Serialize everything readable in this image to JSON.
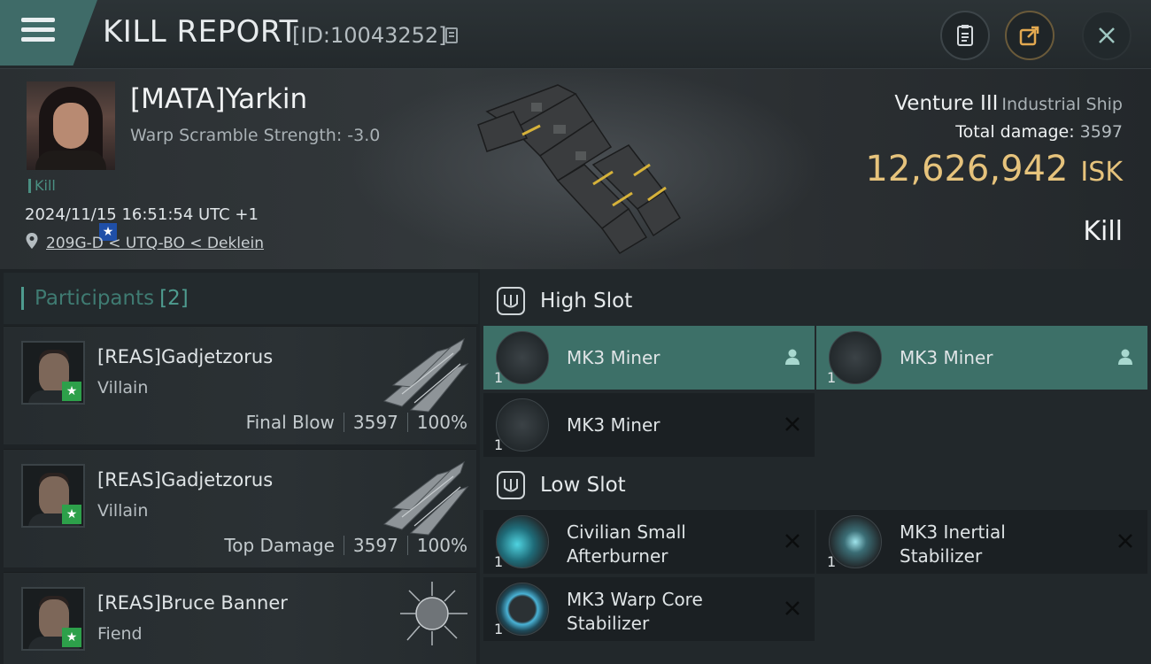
{
  "header": {
    "title": "KILL REPORT",
    "report_id": "[ID:10043252]"
  },
  "victim": {
    "name": "[MATA]Yarkin",
    "warp_scramble": "Warp Scramble Strength: -3.0",
    "tag": "Kill",
    "timestamp": "2024/11/15 16:51:54 UTC +1",
    "location": "209G-D < UTQ-BO < Deklein"
  },
  "ship": {
    "name": "Venture III",
    "class": "Industrial Ship",
    "total_damage_label": "Total damage:",
    "total_damage": "3597",
    "value": "12,626,942",
    "currency": "ISK",
    "result": "Kill"
  },
  "participants": {
    "label": "Participants",
    "count": "[2]",
    "rows": [
      {
        "name": "[REAS]Gadjetzorus",
        "role": "Villain",
        "stat_label": "Final Blow",
        "damage": "3597",
        "percent": "100%"
      },
      {
        "name": "[REAS]Gadjetzorus",
        "role": "Villain",
        "stat_label": "Top Damage",
        "damage": "3597",
        "percent": "100%"
      },
      {
        "name": "[REAS]Bruce Banner",
        "role": "Fiend"
      }
    ]
  },
  "slots": {
    "high": {
      "label": "High Slot",
      "modules": [
        {
          "name": "MK3 Miner",
          "qty": "1"
        },
        {
          "name": "MK3 Miner",
          "qty": "1"
        },
        {
          "name": "MK3 Miner",
          "qty": "1"
        }
      ]
    },
    "low": {
      "label": "Low Slot",
      "modules": [
        {
          "name_l1": "Civilian Small",
          "name_l2": "Afterburner",
          "qty": "1"
        },
        {
          "name_l1": "MK3 Inertial",
          "name_l2": "Stabilizer",
          "qty": "1"
        },
        {
          "name_l1": "MK3 Warp Core",
          "name_l2": "Stabilizer",
          "qty": "1"
        }
      ]
    }
  },
  "colors": {
    "accent_teal": "#3d7068",
    "isk_gold": "#e6c37c",
    "star_green": "#2da04a",
    "star_blue": "#1f4fa8"
  }
}
